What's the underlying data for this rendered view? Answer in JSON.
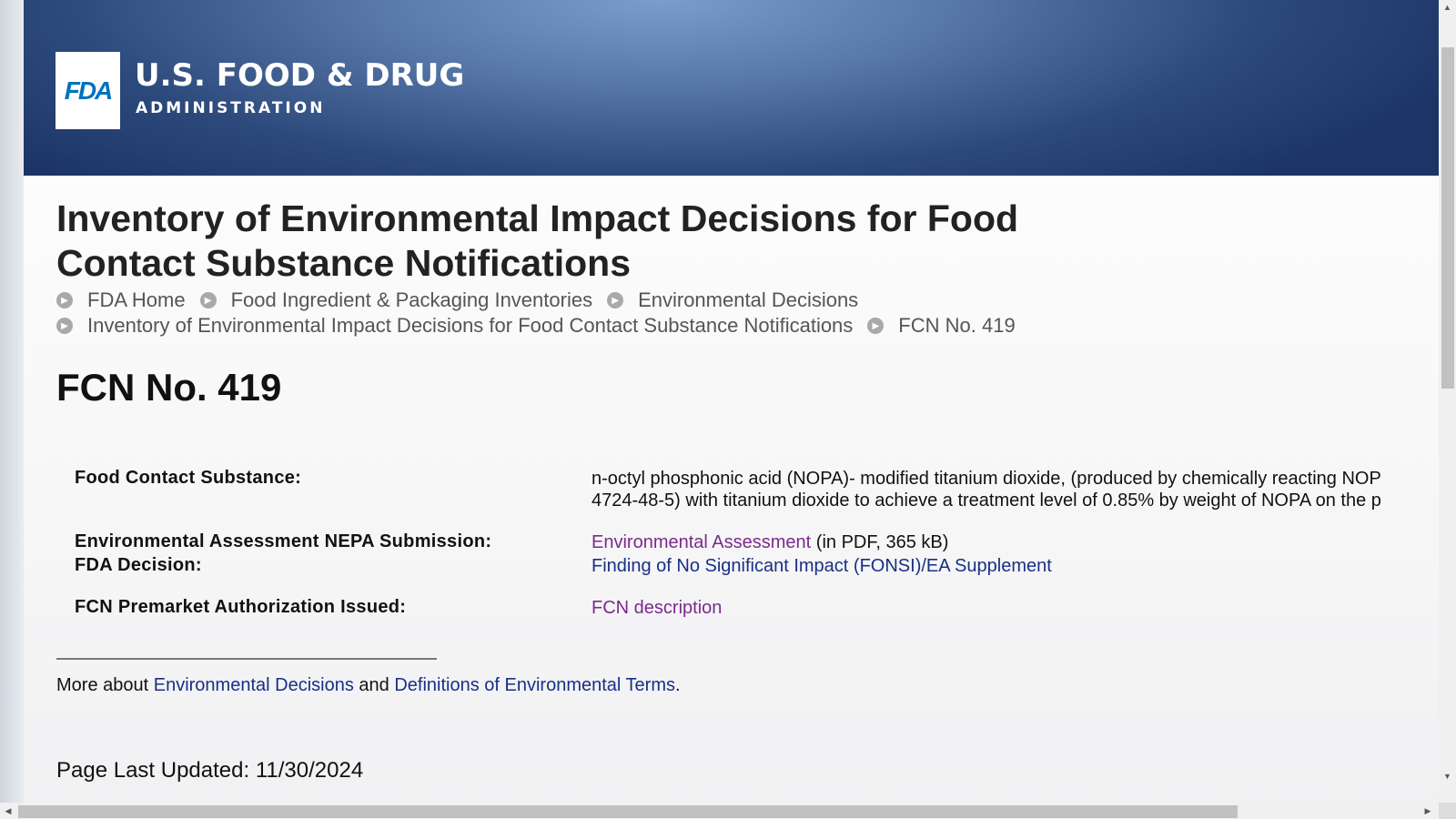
{
  "header": {
    "logo_text": "FDA",
    "agency_name": "U.S. FOOD & DRUG",
    "agency_sub": "ADMINISTRATION"
  },
  "page": {
    "title": "Inventory of Environmental Impact Decisions for Food Contact Substance Notifications"
  },
  "breadcrumbs": [
    {
      "label": "FDA Home"
    },
    {
      "label": "Food Ingredient & Packaging Inventories"
    },
    {
      "label": "Environmental Decisions"
    },
    {
      "label": "Inventory of Environmental Impact Decisions for Food Contact Substance Notifications"
    },
    {
      "label": "FCN No. 419"
    }
  ],
  "content": {
    "heading": "FCN No. 419",
    "fields": {
      "fcs_label": "Food Contact Substance:",
      "fcs_value_line1": "n-octyl phosphonic acid (NOPA)- modified titanium dioxide, (produced by chemically reacting NOP",
      "fcs_value_line2": "4724-48-5) with titanium dioxide to achieve a treatment level of 0.85% by weight of NOPA on the p",
      "ea_label": "Environmental Assessment NEPA Submission:",
      "ea_link": "Environmental Assessment",
      "ea_suffix": " (in PDF, 365 kB)",
      "decision_label": "FDA Decision:",
      "decision_link": "Finding of No Significant Impact (FONSI)/EA Supplement",
      "auth_label": "FCN Premarket Authorization Issued:",
      "auth_link": "FCN description"
    },
    "more": {
      "prefix": "More about ",
      "link1": "Environmental Decisions",
      "middle": " and ",
      "link2": "Definitions of Environmental Terms",
      "suffix": "."
    },
    "updated": "Page Last Updated: 11/30/2024"
  },
  "colors": {
    "header_dark": "#1c3566",
    "header_light": "#7a9dcc",
    "link": "#1a2f84",
    "link_visited": "#7b2a8c"
  }
}
